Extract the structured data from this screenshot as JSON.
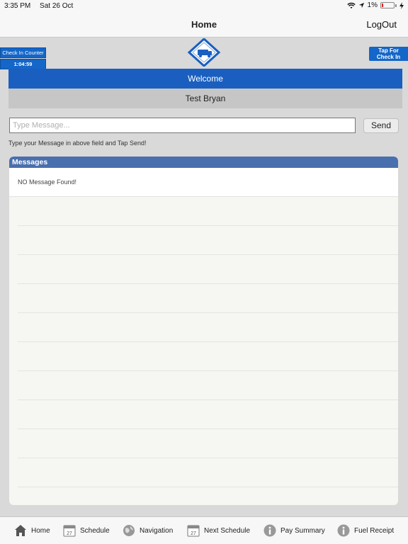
{
  "status": {
    "time": "3:35 PM",
    "date": "Sat 26 Oct",
    "battery": "1%"
  },
  "nav": {
    "title": "Home",
    "logout": "LogOut"
  },
  "checkin_counter": {
    "label": "Check In Counter",
    "time": "1:04:59"
  },
  "tap_checkin": {
    "line1": "Tap For",
    "line2": "Check In"
  },
  "welcome": "Welcome",
  "user_name": "Test Bryan",
  "message": {
    "placeholder": "Type Message...",
    "value": "",
    "send_label": "Send",
    "hint": "Type your Message in above field and Tap Send!"
  },
  "messages": {
    "header": "Messages",
    "empty_text": "NO Message Found!"
  },
  "tabs": [
    {
      "label": "Home",
      "icon": "home-icon"
    },
    {
      "label": "Schedule",
      "icon": "calendar-icon",
      "icon_text": "27"
    },
    {
      "label": "Navigation",
      "icon": "globe-icon"
    },
    {
      "label": "Next Schedule",
      "icon": "calendar-icon",
      "icon_text": "27"
    },
    {
      "label": "Pay Summary",
      "icon": "info-icon"
    },
    {
      "label": "Fuel Receipt",
      "icon": "info-icon"
    }
  ],
  "colors": {
    "accent": "#1466c8",
    "welcome_bar": "#1a5fbf",
    "messages_header": "#4a6fae"
  }
}
